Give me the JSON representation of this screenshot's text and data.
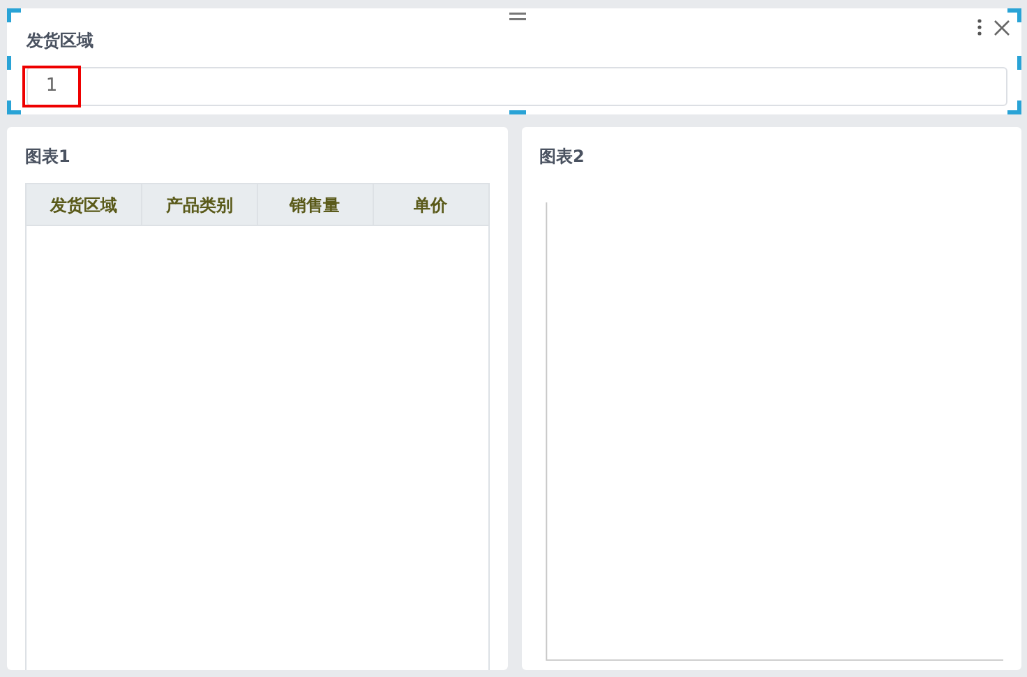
{
  "filter": {
    "title": "发货区域",
    "value": "1",
    "selected": true
  },
  "table_panel": {
    "title": "图表1",
    "columns": [
      "发货区域",
      "产品类别",
      "销售量",
      "单价"
    ]
  },
  "chart_panel": {
    "title": "图表2"
  }
}
